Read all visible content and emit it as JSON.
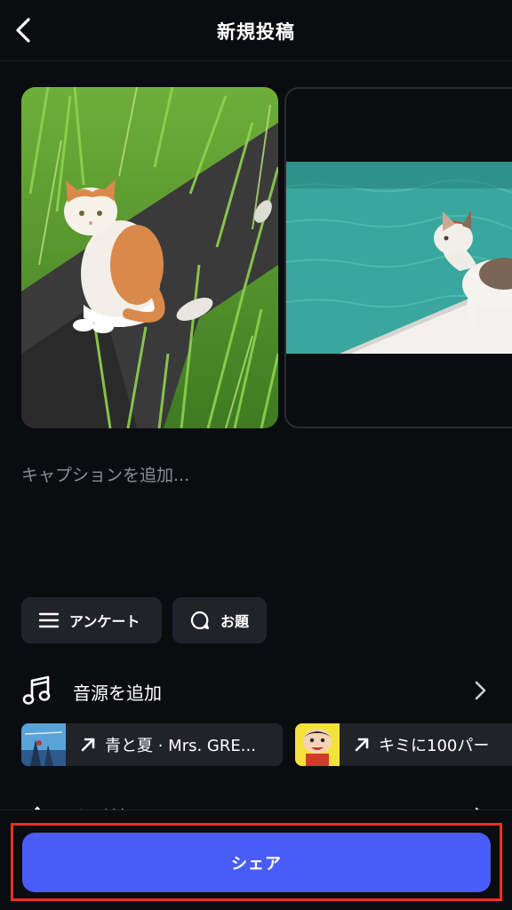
{
  "header": {
    "title": "新規投稿",
    "back_icon": "chevron-left-icon"
  },
  "media": [
    {
      "description_icon": "photo-thumbnail",
      "subject": "cat-in-grass"
    },
    {
      "description_icon": "photo-thumbnail",
      "subject": "cat-by-water"
    }
  ],
  "caption": {
    "placeholder": "キャプションを追加...",
    "value": ""
  },
  "chips": {
    "survey_label": "アンケート",
    "survey_icon": "list-icon",
    "topic_label": "お題",
    "topic_icon": "speech-bubble-icon"
  },
  "music": {
    "label": "音源を追加",
    "icon": "music-note-icon",
    "songs": [
      {
        "label": "青と夏 · Mrs. GRE..."
      },
      {
        "label": "キミに100パー"
      }
    ]
  },
  "tag_row": {
    "label": "タグ付け"
  },
  "share": {
    "label": "シェア"
  },
  "colors": {
    "background": "#0b0c10",
    "chip": "#22232a",
    "accent": "#4a5cf7",
    "highlight": "#e8321e"
  }
}
